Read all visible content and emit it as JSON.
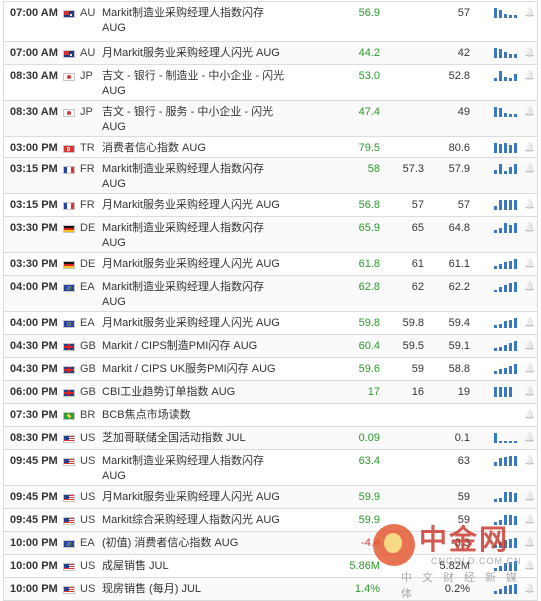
{
  "colors": {
    "positive": "#2a9a2a",
    "negative": "#d13b3b",
    "bar": "#3a78c2",
    "border": "#dcdcdc"
  },
  "rows": [
    {
      "time": "07:00 AM",
      "flag": "au",
      "country": "AU",
      "event": "Markit制造业采购经理人指数闪存",
      "event2": "AUG",
      "actual": "56.9",
      "tone": "pos",
      "forecast": "",
      "previous": "57",
      "bars": [
        10,
        8,
        4,
        3,
        3
      ],
      "h": 39
    },
    {
      "time": "07:00 AM",
      "flag": "au",
      "country": "AU",
      "event": "月Markit服务业采购经理人闪光 AUG",
      "event2": "",
      "actual": "44.2",
      "tone": "pos",
      "forecast": "",
      "previous": "42",
      "bars": [
        10,
        9,
        6,
        4,
        4
      ],
      "h": 22
    },
    {
      "time": "08:30 AM",
      "flag": "jp",
      "country": "JP",
      "event": "吉文 - 银行 - 制造业 - 中小企业 - 闪光",
      "event2": "AUG",
      "actual": "53.0",
      "tone": "pos",
      "forecast": "",
      "previous": "52.8",
      "bars": [
        3,
        10,
        4,
        3,
        7
      ],
      "h": 35
    },
    {
      "time": "08:30 AM",
      "flag": "jp",
      "country": "JP",
      "event": "吉文 - 银行 - 服务 - 中小企业 - 闪光",
      "event2": "AUG",
      "actual": "47.4",
      "tone": "pos",
      "forecast": "",
      "previous": "49",
      "bars": [
        10,
        9,
        4,
        3,
        3
      ],
      "h": 35
    },
    {
      "time": "03:00 PM",
      "flag": "tr",
      "country": "TR",
      "event": "消费者信心指数 AUG",
      "event2": "",
      "actual": "79.5",
      "tone": "pos",
      "forecast": "",
      "previous": "80.6",
      "bars": [
        10,
        9,
        10,
        8,
        10
      ],
      "h": 20
    },
    {
      "time": "03:15 PM",
      "flag": "fr",
      "country": "FR",
      "event": "Markit制造业采购经理人指数闪存",
      "event2": "AUG",
      "actual": "58",
      "tone": "pos",
      "forecast": "57.3",
      "previous": "57.9",
      "bars": [
        4,
        10,
        3,
        7,
        10
      ],
      "h": 35
    },
    {
      "time": "03:15 PM",
      "flag": "fr",
      "country": "FR",
      "event": "月Markit服务业采购经理人闪光 AUG",
      "event2": "",
      "actual": "56.8",
      "tone": "pos",
      "forecast": "57",
      "previous": "57",
      "bars": [
        4,
        10,
        10,
        10,
        10
      ],
      "h": 22
    },
    {
      "time": "03:30 PM",
      "flag": "de",
      "country": "DE",
      "event": "Markit制造业采购经理人指数闪存",
      "event2": "AUG",
      "actual": "65.9",
      "tone": "pos",
      "forecast": "65",
      "previous": "64.8",
      "bars": [
        3,
        5,
        10,
        8,
        10
      ],
      "h": 35
    },
    {
      "time": "03:30 PM",
      "flag": "de",
      "country": "DE",
      "event": "月Markit服务业采购经理人闪光 AUG",
      "event2": "",
      "actual": "61.8",
      "tone": "pos",
      "forecast": "61",
      "previous": "61.1",
      "bars": [
        3,
        5,
        7,
        8,
        10
      ],
      "h": 22
    },
    {
      "time": "04:00 PM",
      "flag": "ea",
      "country": "EA",
      "event": "Markit制造业采购经理人指数闪存",
      "event2": "AUG",
      "actual": "62.8",
      "tone": "pos",
      "forecast": "62",
      "previous": "62.2",
      "bars": [
        2,
        5,
        7,
        9,
        10
      ],
      "h": 35
    },
    {
      "time": "04:00 PM",
      "flag": "ea",
      "country": "EA",
      "event": "月Markit服务业采购经理人闪光 AUG",
      "event2": "",
      "actual": "59.8",
      "tone": "pos",
      "forecast": "59.8",
      "previous": "59.4",
      "bars": [
        3,
        4,
        7,
        8,
        10
      ],
      "h": 22
    },
    {
      "time": "04:30 PM",
      "flag": "gb",
      "country": "GB",
      "event": "Markit / CIPS制造PMI闪存 AUG",
      "event2": "",
      "actual": "60.4",
      "tone": "pos",
      "forecast": "59.5",
      "previous": "59.1",
      "bars": [
        3,
        4,
        6,
        8,
        10
      ],
      "h": 22
    },
    {
      "time": "04:30 PM",
      "flag": "gb",
      "country": "GB",
      "event": "Markit / CIPS UK服务PMI闪存 AUG",
      "event2": "",
      "actual": "59.6",
      "tone": "pos",
      "forecast": "59",
      "previous": "58.8",
      "bars": [
        3,
        5,
        6,
        8,
        10
      ],
      "h": 22
    },
    {
      "time": "06:00 PM",
      "flag": "gb",
      "country": "GB",
      "event": "CBI工业趋势订单指数 AUG",
      "event2": "",
      "actual": "17",
      "tone": "pos",
      "forecast": "16",
      "previous": "19",
      "bars": [
        10,
        10,
        10,
        10,
        0
      ],
      "h": 22
    },
    {
      "time": "07:30 PM",
      "flag": "br",
      "country": "BR",
      "event": "BCB焦点市场读数",
      "event2": "",
      "actual": "",
      "tone": "neu",
      "forecast": "",
      "previous": "",
      "bars": [],
      "h": 22
    },
    {
      "time": "08:30 PM",
      "flag": "us",
      "country": "US",
      "event": "芝加哥联储全国活动指数 JUL",
      "event2": "",
      "actual": "0.09",
      "tone": "pos",
      "forecast": "",
      "previous": "0.1",
      "bars": [
        10,
        2,
        2,
        2,
        2
      ],
      "h": 22
    },
    {
      "time": "09:45 PM",
      "flag": "us",
      "country": "US",
      "event": "Markit制造业采购经理人指数闪存",
      "event2": "AUG",
      "actual": "63.4",
      "tone": "pos",
      "forecast": "",
      "previous": "63",
      "bars": [
        4,
        8,
        9,
        10,
        10
      ],
      "h": 35
    },
    {
      "time": "09:45 PM",
      "flag": "us",
      "country": "US",
      "event": "月Markit服务业采购经理人闪光 AUG",
      "event2": "",
      "actual": "59.9",
      "tone": "pos",
      "forecast": "",
      "previous": "59",
      "bars": [
        3,
        4,
        10,
        10,
        9
      ],
      "h": 22
    },
    {
      "time": "09:45 PM",
      "flag": "us",
      "country": "US",
      "event": "Markit综合采购经理人指数闪光 AUG",
      "event2": "",
      "actual": "59.9",
      "tone": "pos",
      "forecast": "",
      "previous": "59",
      "bars": [
        3,
        5,
        10,
        10,
        9
      ],
      "h": 22
    },
    {
      "time": "10:00 PM",
      "flag": "ea",
      "country": "EA",
      "event": "(初值) 消费者信心指数 AUG",
      "event2": "",
      "actual": "-4.4",
      "tone": "neg",
      "forecast": "",
      "previous": "-3.3",
      "bars": [
        3,
        6,
        8,
        9,
        10
      ],
      "h": 22
    },
    {
      "time": "10:00 PM",
      "flag": "us",
      "country": "US",
      "event": "成屋销售 JUL",
      "event2": "",
      "actual": "5.86M",
      "tone": "pos",
      "forecast": "",
      "previous": "5.82M",
      "bars": [
        3,
        5,
        8,
        9,
        10
      ],
      "h": 22
    },
    {
      "time": "10:00 PM",
      "flag": "us",
      "country": "US",
      "event": "现房销售 (每月) JUL",
      "event2": "",
      "actual": "1.4%",
      "tone": "pos",
      "forecast": "",
      "previous": "0.2%",
      "bars": [
        3,
        5,
        8,
        9,
        10
      ],
      "h": 22
    }
  ],
  "watermark": {
    "title": "中金网",
    "url": "CNGOLD.COM.CN",
    "subtitle": "中文财经新媒体"
  }
}
